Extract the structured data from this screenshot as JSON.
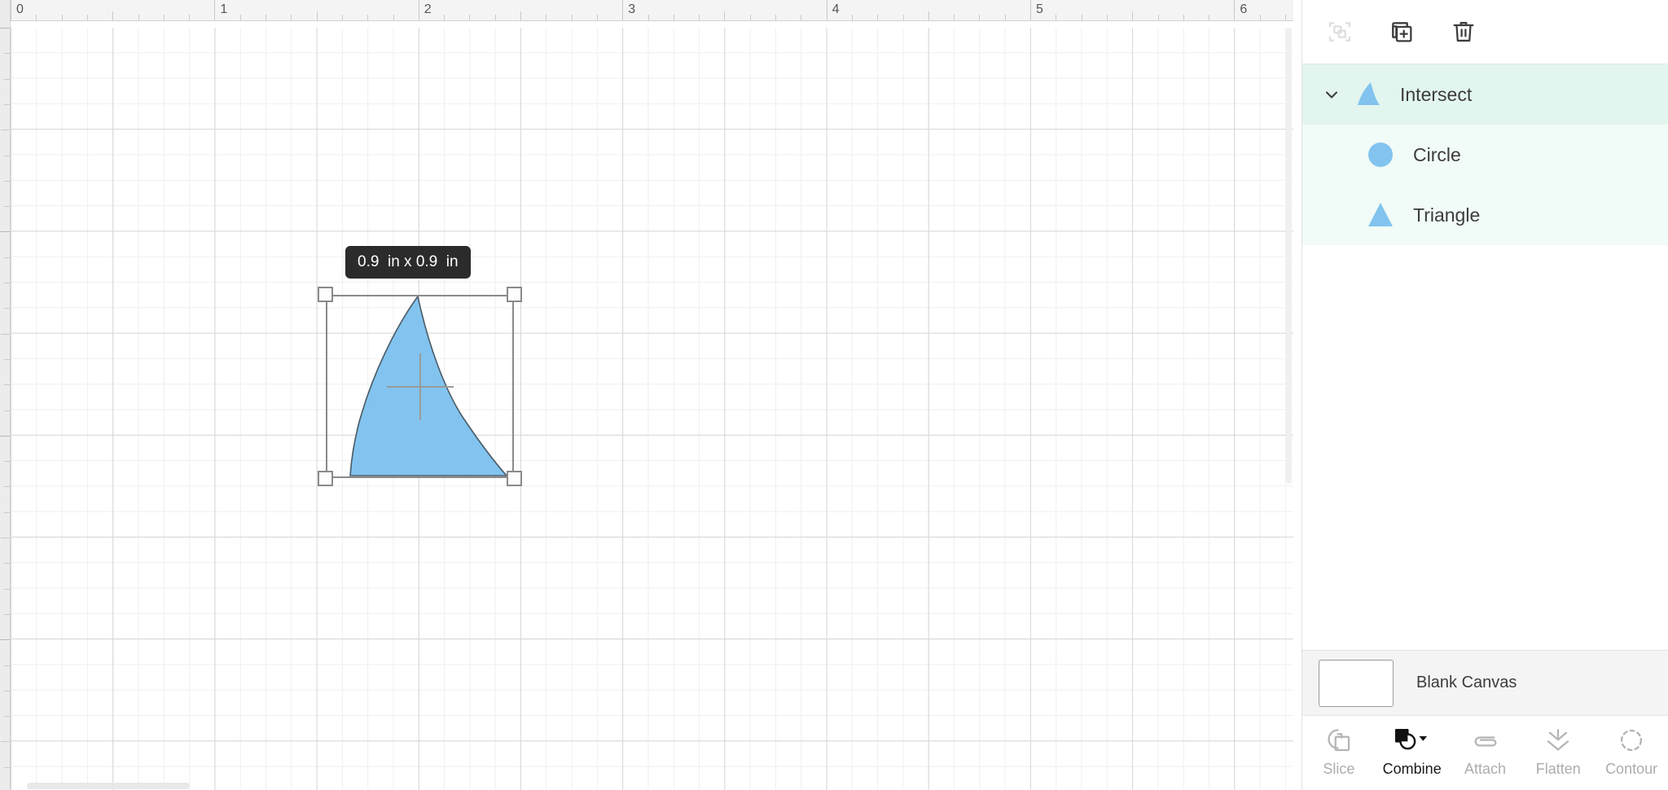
{
  "canvas": {
    "ruler_unit": "in",
    "ruler_ticks_h": [
      "0",
      "1",
      "2",
      "3",
      "4",
      "5",
      "6"
    ],
    "dimension_tooltip": "0.9  in x 0.9  in",
    "shape_fill": "#82c4ef",
    "shape_stroke": "#4a5a66",
    "selection_color": "#8a8a8a",
    "grid_major_color": "#d6d6d6",
    "grid_minor_color": "#efefef"
  },
  "panel": {
    "top_tools": [
      {
        "name": "group-ungroup-icon",
        "label": "Ungroup",
        "enabled": false
      },
      {
        "name": "duplicate-icon",
        "label": "Duplicate",
        "enabled": true
      },
      {
        "name": "delete-icon",
        "label": "Delete",
        "enabled": true
      }
    ],
    "layers": [
      {
        "label": "Intersect",
        "thumb": "intersect",
        "level": 0,
        "expanded": true,
        "selected": true
      },
      {
        "label": "Circle",
        "thumb": "circle",
        "level": 1,
        "expanded": false,
        "selected": true
      },
      {
        "label": "Triangle",
        "thumb": "triangle",
        "level": 1,
        "expanded": false,
        "selected": true
      }
    ],
    "canvas_row": {
      "label": "Blank Canvas",
      "swatch_color": "#ffffff"
    },
    "operations": [
      {
        "label": "Slice",
        "icon": "slice-icon",
        "enabled": false,
        "active": false,
        "dropdown": false
      },
      {
        "label": "Combine",
        "icon": "combine-icon",
        "enabled": true,
        "active": true,
        "dropdown": true
      },
      {
        "label": "Attach",
        "icon": "attach-icon",
        "enabled": false,
        "active": false,
        "dropdown": false
      },
      {
        "label": "Flatten",
        "icon": "flatten-icon",
        "enabled": false,
        "active": false,
        "dropdown": false
      },
      {
        "label": "Contour",
        "icon": "contour-icon",
        "enabled": false,
        "active": false,
        "dropdown": false
      }
    ]
  }
}
